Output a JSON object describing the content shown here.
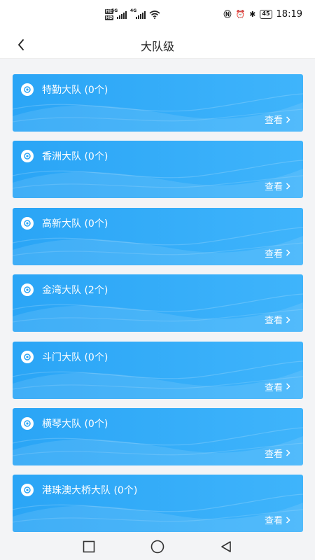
{
  "status": {
    "time": "18:19",
    "battery": "45",
    "hd1": "HD",
    "hd2": "HD",
    "net1": "5G",
    "net2": "4G"
  },
  "header": {
    "title": "大队级",
    "back_icon": "chevron-left-icon"
  },
  "list": {
    "link_label": "查看",
    "items": [
      {
        "title": "特勤大队 (0个)"
      },
      {
        "title": "香洲大队 (0个)"
      },
      {
        "title": "高新大队 (0个)"
      },
      {
        "title": "金湾大队 (2个)"
      },
      {
        "title": "斗门大队 (0个)"
      },
      {
        "title": "横琴大队 (0个)"
      },
      {
        "title": "港珠澳大桥大队 (0个)"
      }
    ]
  },
  "colors": {
    "card_start": "#2aa5f6",
    "card_end": "#3fb4fb",
    "nav_bg": "#ffffff",
    "page_bg": "#f3f4f6"
  },
  "system_nav": {
    "recent_icon": "square-icon",
    "home_icon": "circle-icon",
    "back_icon": "triangle-back-icon"
  }
}
